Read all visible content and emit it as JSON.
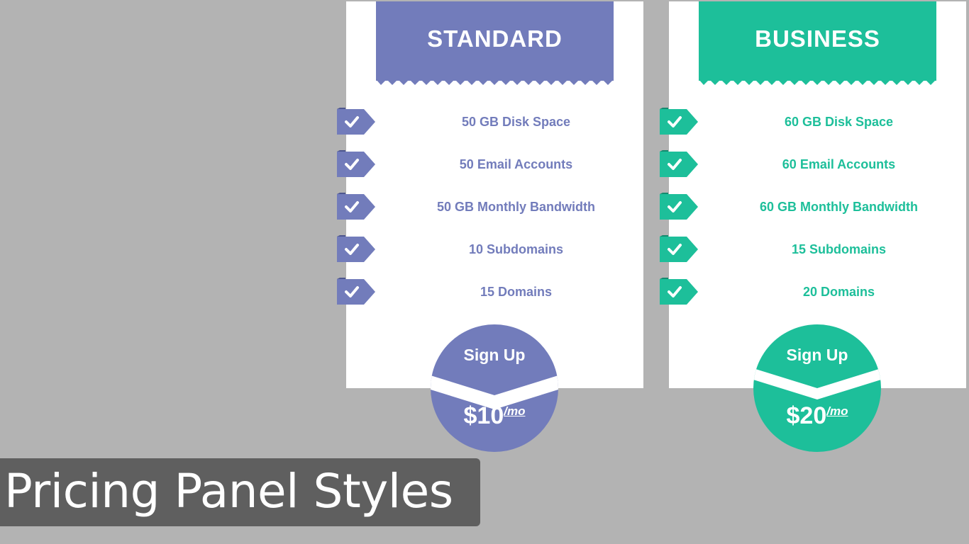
{
  "colors": {
    "standard": "#727cbb",
    "business": "#1dbf9a",
    "background": "#b3b3b3",
    "caption_bg": "#5f5f5f"
  },
  "plans": [
    {
      "title": "STANDARD",
      "features": [
        "50 GB Disk Space",
        "50 Email Accounts",
        "50 GB Monthly Bandwidth",
        "10 Subdomains",
        "15 Domains"
      ],
      "signup": "Sign Up",
      "price": "$10",
      "period": "/mo",
      "feature_icon": "check-icon"
    },
    {
      "title": "BUSINESS",
      "features": [
        "60 GB Disk Space",
        "60 Email Accounts",
        "60 GB Monthly Bandwidth",
        "15 Subdomains",
        "20 Domains"
      ],
      "signup": "Sign Up",
      "price": "$20",
      "period": "/mo",
      "feature_icon": "check-icon"
    }
  ],
  "caption": "Pricing Panel Styles"
}
